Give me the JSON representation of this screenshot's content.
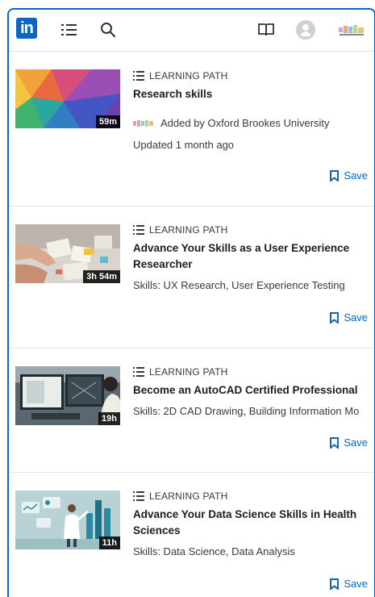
{
  "header": {
    "logo_text": "in",
    "icons": [
      "list-icon",
      "search-icon",
      "book-icon",
      "avatar",
      "org-logo"
    ]
  },
  "colors": {
    "brand": "#0a66c2",
    "text": "#1d1d1d",
    "muted": "#3a3a3a",
    "divider": "#e3e3e3"
  },
  "items": [
    {
      "kind": "LEARNING PATH",
      "title": "Research skills",
      "duration": "59m",
      "added_by": "Added by Oxford Brookes University",
      "updated": "Updated 1 month ago",
      "save_label": "Save"
    },
    {
      "kind": "LEARNING PATH",
      "title_line1": "Advance Your Skills as a User Experience",
      "title_line2": "Researcher",
      "duration": "3h 54m",
      "skills": "Skills: UX Research, User Experience Testing",
      "save_label": "Save"
    },
    {
      "kind": "LEARNING PATH",
      "title": "Become an AutoCAD Certified Professional",
      "duration": "19h",
      "skills": "Skills: 2D CAD Drawing, Building Information Mo",
      "save_label": "Save"
    },
    {
      "kind": "LEARNING PATH",
      "title_line1": "Advance Your Data Science Skills in Health",
      "title_line2": "Sciences",
      "duration": "11h",
      "skills": "Skills: Data Science, Data Analysis",
      "save_label": "Save"
    }
  ]
}
